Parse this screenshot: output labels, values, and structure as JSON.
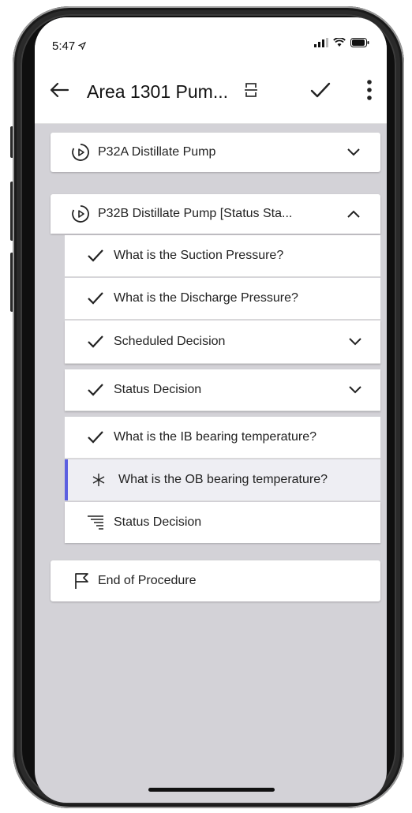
{
  "status_bar": {
    "time": "5:47"
  },
  "app_bar": {
    "title": "Area 1301 Pum..."
  },
  "sections": [
    {
      "label": "P32A Distillate Pump",
      "expanded": false
    },
    {
      "label": "P32B Distillate Pump [Status Sta...",
      "expanded": true
    }
  ],
  "steps": [
    {
      "label": "What is the Suction Pressure?",
      "state": "done"
    },
    {
      "label": "What is the Discharge Pressure?",
      "state": "done"
    },
    {
      "label": "Scheduled Decision",
      "state": "done",
      "has_chevron": true
    },
    {
      "label": "Status Decision",
      "state": "done",
      "has_chevron": true
    },
    {
      "label": "What is the IB bearing temperature?",
      "state": "done"
    },
    {
      "label": "What is the OB bearing temperature?",
      "state": "current"
    },
    {
      "label": "Status Decision",
      "state": "pending"
    }
  ],
  "end_item": {
    "label": "End of Procedure"
  },
  "colors": {
    "accent": "#5b5fe0",
    "screen_bg": "#d3d2d7"
  }
}
